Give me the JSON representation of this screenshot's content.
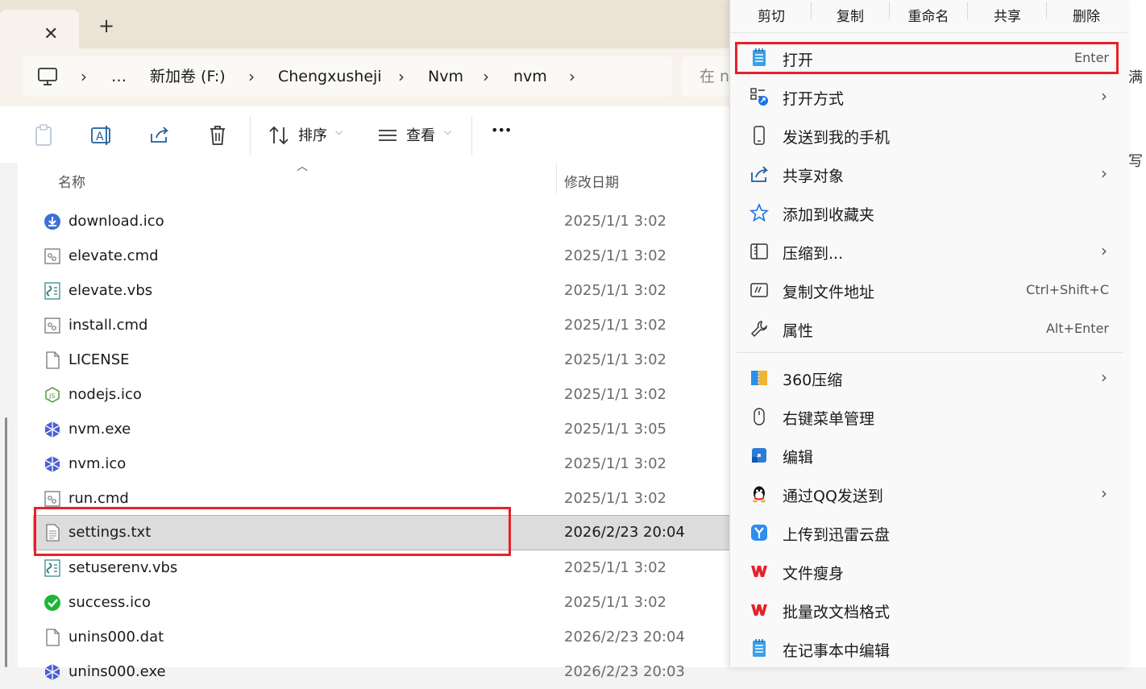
{
  "tabs": {
    "close_glyph": "✕",
    "new_glyph": "+"
  },
  "address": {
    "crumbs": [
      "…",
      "新加卷 (F:)",
      "Chengxusheji",
      "Nvm",
      "nvm"
    ],
    "search_placeholder": "在 n"
  },
  "toolbar": {
    "sort_label": "排序",
    "view_label": "查看",
    "more_label": "•••"
  },
  "columns": {
    "name": "名称",
    "date": "修改日期"
  },
  "files": [
    {
      "name": "download.ico",
      "date": "2025/1/1 3:02",
      "icon": "download-icon"
    },
    {
      "name": "elevate.cmd",
      "date": "2025/1/1 3:02",
      "icon": "cmd-file-icon"
    },
    {
      "name": "elevate.vbs",
      "date": "2025/1/1 3:02",
      "icon": "vbs-file-icon"
    },
    {
      "name": "install.cmd",
      "date": "2025/1/1 3:02",
      "icon": "cmd-file-icon"
    },
    {
      "name": "LICENSE",
      "date": "2025/1/1 3:02",
      "icon": "blank-file-icon"
    },
    {
      "name": "nodejs.ico",
      "date": "2025/1/1 3:02",
      "icon": "nodejs-icon"
    },
    {
      "name": "nvm.exe",
      "date": "2025/1/1 3:05",
      "icon": "nvm-icon"
    },
    {
      "name": "nvm.ico",
      "date": "2025/1/1 3:02",
      "icon": "nvm-icon"
    },
    {
      "name": "run.cmd",
      "date": "2025/1/1 3:02",
      "icon": "cmd-file-icon"
    },
    {
      "name": "settings.txt",
      "date": "2026/2/23 20:04",
      "icon": "text-file-icon",
      "selected": true
    },
    {
      "name": "setuserenv.vbs",
      "date": "2025/1/1 3:02",
      "icon": "vbs-file-icon"
    },
    {
      "name": "success.ico",
      "date": "2025/1/1 3:02",
      "icon": "success-icon"
    },
    {
      "name": "unins000.dat",
      "date": "2026/2/23 20:04",
      "icon": "blank-file-icon"
    },
    {
      "name": "unins000.exe",
      "date": "2026/2/23 20:03",
      "icon": "nvm-icon"
    }
  ],
  "context_menu": {
    "top_actions": [
      "剪切",
      "复制",
      "重命名",
      "共享",
      "删除"
    ],
    "group1": [
      {
        "label": "打开",
        "shortcut": "Enter",
        "icon": "notepad-icon",
        "submenu": false
      },
      {
        "label": "打开方式",
        "shortcut": "",
        "icon": "open-with-icon",
        "submenu": true
      },
      {
        "label": "发送到我的手机",
        "shortcut": "",
        "icon": "phone-icon",
        "submenu": false
      },
      {
        "label": "共享对象",
        "shortcut": "",
        "icon": "share-icon",
        "submenu": true
      },
      {
        "label": "添加到收藏夹",
        "shortcut": "",
        "icon": "star-icon",
        "submenu": false
      },
      {
        "label": "压缩到...",
        "shortcut": "",
        "icon": "zip-icon",
        "submenu": true
      },
      {
        "label": "复制文件地址",
        "shortcut": "Ctrl+Shift+C",
        "icon": "copy-path-icon",
        "submenu": false
      },
      {
        "label": "属性",
        "shortcut": "Alt+Enter",
        "icon": "wrench-icon",
        "submenu": false
      }
    ],
    "group2": [
      {
        "label": "360压缩",
        "icon": "360zip-icon",
        "submenu": true
      },
      {
        "label": "右键菜单管理",
        "icon": "mouse-icon",
        "submenu": false
      },
      {
        "label": "编辑",
        "icon": "edit-icon",
        "submenu": false
      },
      {
        "label": "通过QQ发送到",
        "icon": "qq-icon",
        "submenu": true
      },
      {
        "label": "上传到迅雷云盘",
        "icon": "xunlei-icon",
        "submenu": false
      },
      {
        "label": "文件瘦身",
        "icon": "wps-icon",
        "submenu": false
      },
      {
        "label": "批量改文档格式",
        "icon": "wps-icon",
        "submenu": false
      },
      {
        "label": "在记事本中编辑",
        "icon": "notepad-icon",
        "submenu": false
      }
    ]
  },
  "behind_fragments": [
    "满",
    "写"
  ],
  "colors": {
    "highlight": "#e8202a",
    "accent": "#1a73e8",
    "wps": "#e8202a"
  }
}
